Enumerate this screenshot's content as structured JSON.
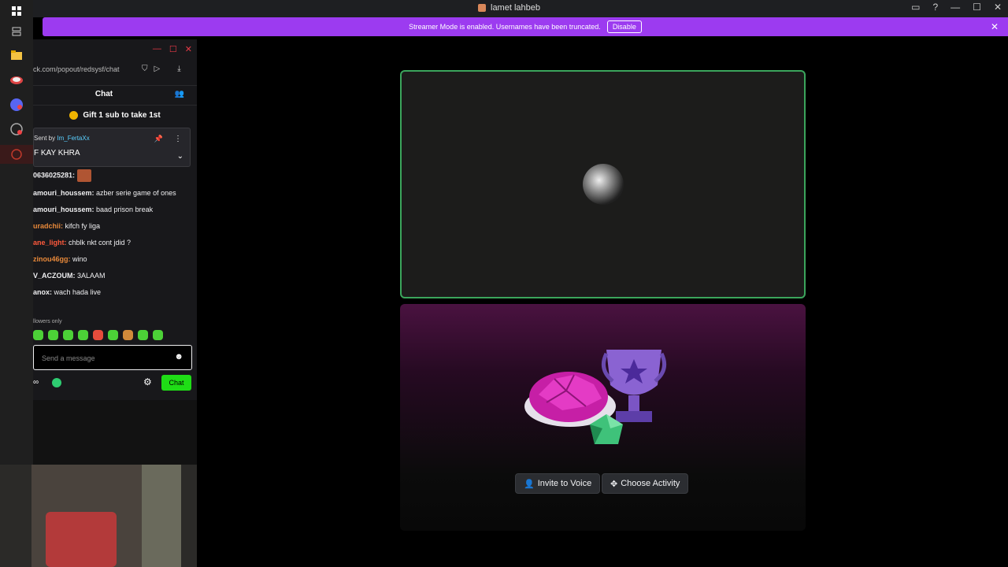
{
  "window": {
    "title": "lamet lahbeb",
    "controls": [
      "▭",
      "?",
      "—",
      "☐",
      "✕"
    ]
  },
  "banner": {
    "text": "Streamer Mode is enabled. Usernames have been truncated.",
    "disable_label": "Disable",
    "close_glyph": "✕"
  },
  "chat": {
    "url": "ck.com/popout/redsysf/chat",
    "header_title": "Chat",
    "gift_text": "Gift 1 sub to take 1st",
    "pinned": {
      "sent_by_label": "Sent by",
      "sender": "Im_FertaXx",
      "message": "F KAY KHRA"
    },
    "messages": [
      {
        "user": "0636025281:",
        "user_color": "#ffffff",
        "text": "",
        "emote": true
      },
      {
        "user": "amouri_houssem:",
        "user_color": "#ffffff",
        "text": " azber serie game of ones"
      },
      {
        "user": "amouri_houssem:",
        "user_color": "#ffffff",
        "text": " baad prison break"
      },
      {
        "user": "uradchii:",
        "user_color": "#e8893a",
        "text": " kifch fy liga"
      },
      {
        "user": "ane_light:",
        "user_color": "#ff5a3c",
        "text": " chblk nkt cont jdid ?"
      },
      {
        "user": "zinou46gg:",
        "user_color": "#e8893a",
        "text": " wino"
      },
      {
        "user": "V_ACZOUM:",
        "user_color": "#ffffff",
        "text": " 3ALAAM"
      },
      {
        "user": "anox:",
        "user_color": "#ffffff",
        "text": " wach hada live"
      }
    ],
    "followers_only": "llowers only",
    "input_placeholder": "Send a message",
    "chat_button": "Chat",
    "infinity_glyph": "∞"
  },
  "stage": {
    "invite_label": "Invite to Voice",
    "activity_label": "Choose Activity"
  },
  "colors": {
    "banner": "#9c3bf0",
    "speaking_border": "#3ba55c",
    "twitch_green": "#1fdd16"
  }
}
